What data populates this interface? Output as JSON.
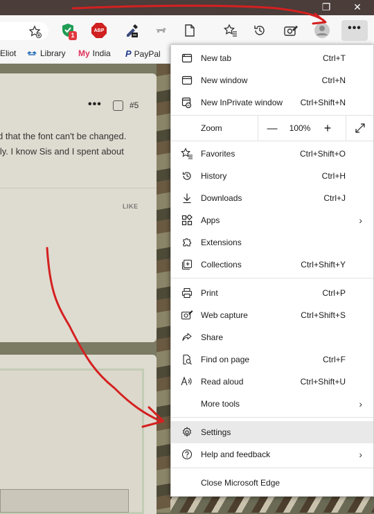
{
  "window": {
    "restore_glyph": "❐",
    "close_glyph": "✕"
  },
  "toolbar": {
    "extension_badge": "1",
    "abp_label": "ABP",
    "more_glyph": "•••"
  },
  "favorites": [
    {
      "label": "Eliot",
      "icon": "none"
    },
    {
      "label": "Library",
      "icon": "library-icon"
    },
    {
      "label": "India",
      "icon": "my-logo-icon",
      "icon_text": "My"
    },
    {
      "label": "PayPal",
      "icon": "paypal-icon",
      "icon_text": "P"
    }
  ],
  "post": {
    "more_glyph": "•••",
    "number": "#5",
    "line1": "d that the font can't be changed.",
    "line2": "lly. I know Sis and I spent about",
    "like_label": "LIKE"
  },
  "menu": {
    "new_tab": {
      "label": "New tab",
      "shortcut": "Ctrl+T"
    },
    "new_window": {
      "label": "New window",
      "shortcut": "Ctrl+N"
    },
    "new_inprivate": {
      "label": "New InPrivate window",
      "shortcut": "Ctrl+Shift+N"
    },
    "zoom": {
      "label": "Zoom",
      "minus": "—",
      "value": "100%",
      "plus": "+"
    },
    "favorites": {
      "label": "Favorites",
      "shortcut": "Ctrl+Shift+O"
    },
    "history": {
      "label": "History",
      "shortcut": "Ctrl+H"
    },
    "downloads": {
      "label": "Downloads",
      "shortcut": "Ctrl+J"
    },
    "apps": {
      "label": "Apps",
      "chevron": "›"
    },
    "extensions": {
      "label": "Extensions"
    },
    "collections": {
      "label": "Collections",
      "shortcut": "Ctrl+Shift+Y"
    },
    "print": {
      "label": "Print",
      "shortcut": "Ctrl+P"
    },
    "web_capture": {
      "label": "Web capture",
      "shortcut": "Ctrl+Shift+S"
    },
    "share": {
      "label": "Share"
    },
    "find_on_page": {
      "label": "Find on page",
      "shortcut": "Ctrl+F"
    },
    "read_aloud": {
      "label": "Read aloud",
      "shortcut": "Ctrl+Shift+U"
    },
    "more_tools": {
      "label": "More tools",
      "chevron": "›"
    },
    "settings": {
      "label": "Settings"
    },
    "help_feedback": {
      "label": "Help and feedback",
      "chevron": "›"
    },
    "close_edge": {
      "label": "Close Microsoft Edge"
    }
  },
  "colors": {
    "annotation_red": "#d42020",
    "menu_highlight": "#e9e9e9",
    "adblock_red": "#d02020",
    "shield_green": "#1f9d55"
  }
}
